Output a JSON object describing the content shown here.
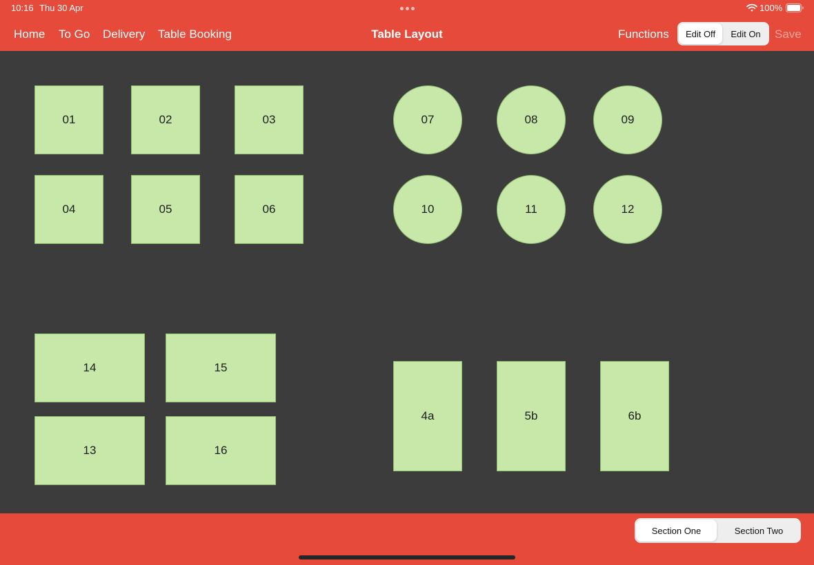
{
  "status_bar": {
    "time": "10:16",
    "date": "Thu 30 Apr",
    "battery_percent": "100%",
    "icons": [
      "more-dots-icon",
      "wifi-icon",
      "battery-icon"
    ]
  },
  "nav": {
    "links": [
      "Home",
      "To Go",
      "Delivery",
      "Table Booking"
    ],
    "title": "Table Layout",
    "functions_label": "Functions",
    "edit_segment": {
      "off_label": "Edit Off",
      "on_label": "Edit On",
      "selected": "Edit Off"
    },
    "save_label": "Save"
  },
  "tables": {
    "squares": [
      "01",
      "02",
      "03",
      "04",
      "05",
      "06"
    ],
    "rounds": [
      "07",
      "08",
      "09",
      "10",
      "11",
      "12"
    ],
    "wide": [
      "14",
      "15",
      "13",
      "16"
    ],
    "tall": [
      "4a",
      "5b",
      "6b"
    ]
  },
  "sections": {
    "options": [
      "Section One",
      "Section Two"
    ],
    "selected": "Section One"
  },
  "colors": {
    "accent": "#e64a3b",
    "canvas": "#3c3c3c",
    "table_fill": "#c7e8a9",
    "table_border": "#93bf72",
    "save_disabled": "#f4a79e"
  }
}
